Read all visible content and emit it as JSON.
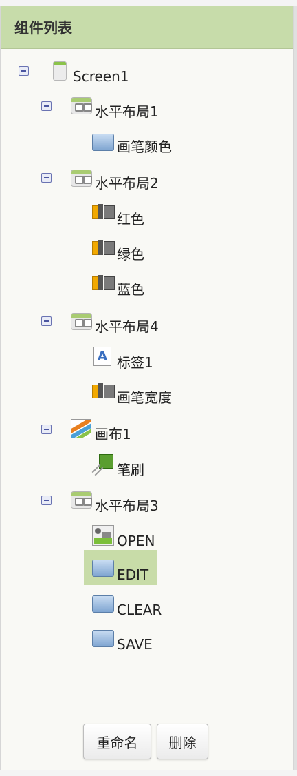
{
  "panel": {
    "title": "组件列表"
  },
  "tree": {
    "screen": "Screen1",
    "hlayout1": "水平布局1",
    "pen_color": "画笔颜色",
    "hlayout2": "水平布局2",
    "red": "红色",
    "green": "绿色",
    "blue": "蓝色",
    "hlayout4": "水平布局4",
    "label1": "标签1",
    "pen_width": "画笔宽度",
    "canvas1": "画布1",
    "brush": "笔刷",
    "hlayout3": "水平布局3",
    "open": "OPEN",
    "edit": "EDIT",
    "clear": "CLEAR",
    "save": "SAVE",
    "selected": "EDIT"
  },
  "actions": {
    "rename": "重命名",
    "delete": "删除"
  },
  "icons": {
    "toggle": "collapse-minus-icon",
    "screen": "screen-icon",
    "hlayout": "horizontal-arrangement-icon",
    "button": "button-icon",
    "slider": "slider-icon",
    "label": "label-icon",
    "canvas": "canvas-icon",
    "sprite": "image-sprite-icon",
    "image": "image-button-icon"
  },
  "colors": {
    "header_bg": "#c7dcaa",
    "selected_bg": "#c8dca8",
    "toggle_border": "#6a73b2"
  }
}
